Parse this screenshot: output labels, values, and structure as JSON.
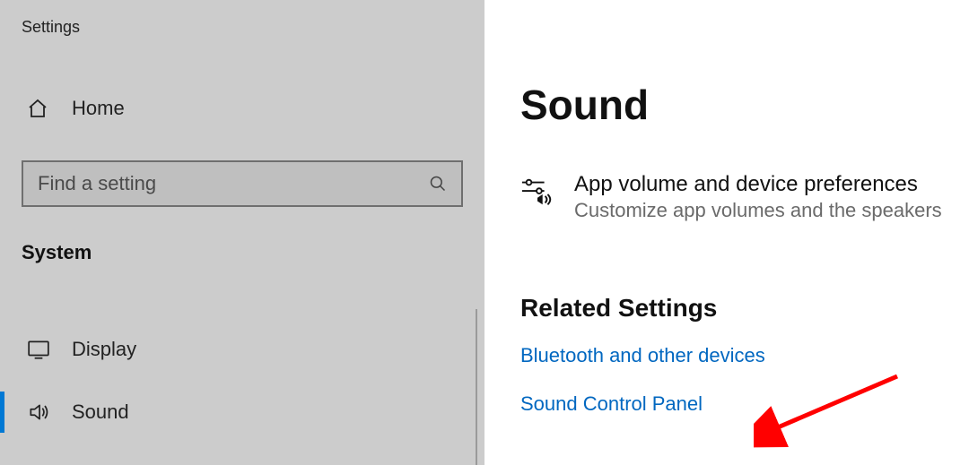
{
  "app": {
    "title": "Settings"
  },
  "sidebar": {
    "home_label": "Home",
    "search_placeholder": "Find a setting",
    "category_heading": "System",
    "items": [
      {
        "label": "Display",
        "active": false
      },
      {
        "label": "Sound",
        "active": true
      }
    ]
  },
  "main": {
    "page_title": "Sound",
    "pref": {
      "title": "App volume and device preferences",
      "subtitle": "Customize app volumes and the speakers"
    },
    "related_heading": "Related Settings",
    "links": [
      {
        "label": "Bluetooth and other devices"
      },
      {
        "label": "Sound Control Panel"
      }
    ]
  }
}
